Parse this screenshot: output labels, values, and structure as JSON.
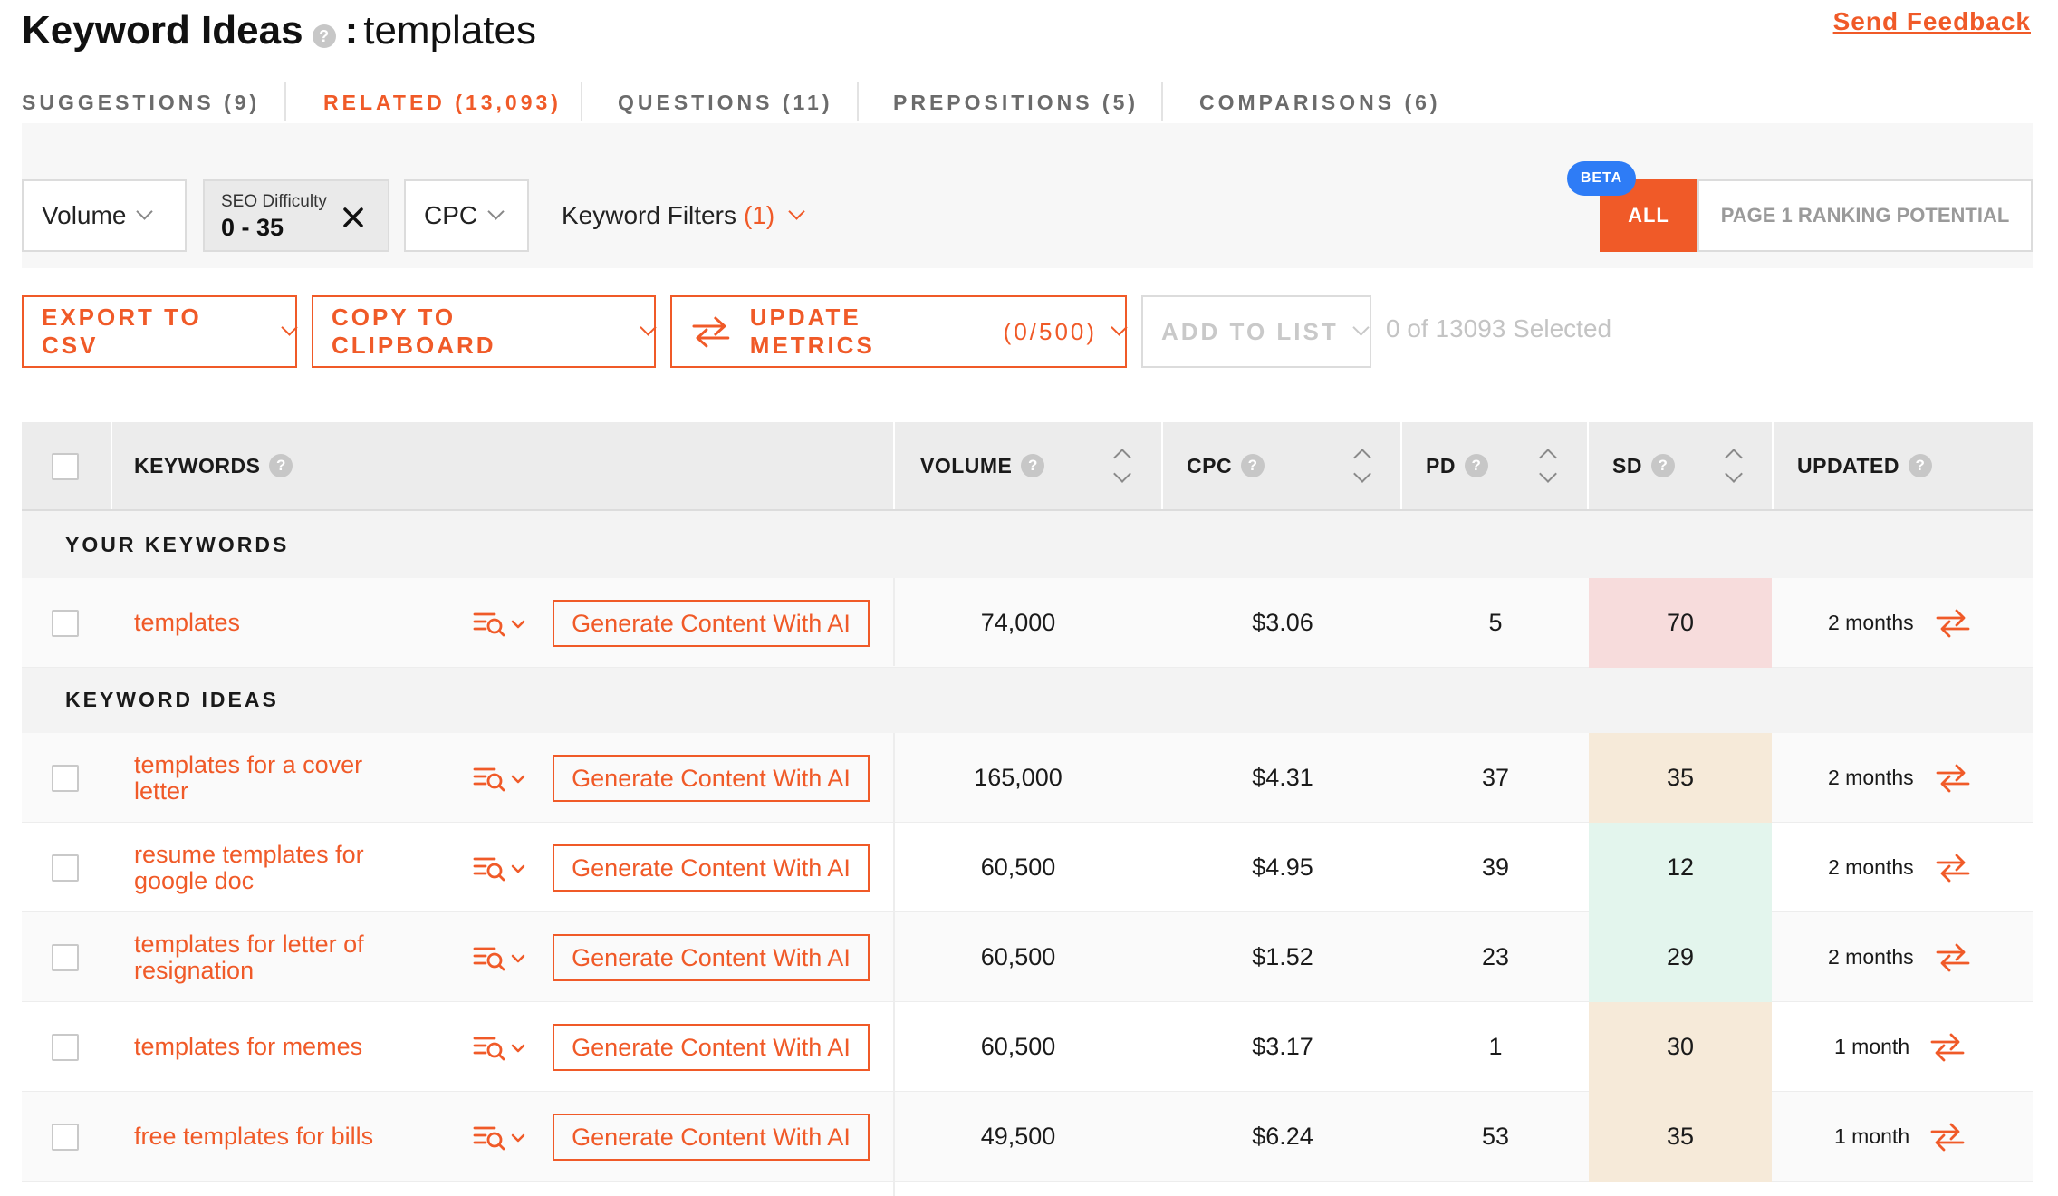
{
  "header": {
    "title": "Keyword Ideas",
    "separator": ":",
    "query": "templates",
    "feedback": "Send Feedback"
  },
  "tabs": [
    {
      "label": "SUGGESTIONS (9)",
      "active": false
    },
    {
      "label": "RELATED (13,093)",
      "active": true
    },
    {
      "label": "QUESTIONS (11)",
      "active": false
    },
    {
      "label": "PREPOSITIONS (5)",
      "active": false
    },
    {
      "label": "COMPARISONS (6)",
      "active": false
    }
  ],
  "filters": {
    "volume": "Volume",
    "seo_label": "SEO Difficulty",
    "seo_value": "0 - 35",
    "cpc": "CPC",
    "keyword_filters": "Keyword Filters",
    "keyword_filters_count": "(1)",
    "beta": "BETA",
    "all": "ALL",
    "page1": "PAGE 1 RANKING POTENTIAL"
  },
  "actions": {
    "export": "EXPORT TO CSV",
    "copy": "COPY TO CLIPBOARD",
    "update": "UPDATE METRICS",
    "update_count": "(0/500)",
    "add_list": "ADD TO LIST",
    "selected": "0 of 13093 Selected"
  },
  "table": {
    "headers": {
      "keywords": "KEYWORDS",
      "volume": "VOLUME",
      "cpc": "CPC",
      "pd": "PD",
      "sd": "SD",
      "updated": "UPDATED"
    },
    "your_section": "YOUR KEYWORDS",
    "ideas_section": "KEYWORD IDEAS",
    "generate_label": "Generate Content With AI",
    "your_rows": [
      {
        "keyword": "templates",
        "volume": "74,000",
        "cpc": "$3.06",
        "pd": "5",
        "sd": "70",
        "updated": "2 months"
      }
    ],
    "idea_rows": [
      {
        "keyword": "templates for a cover letter",
        "volume": "165,000",
        "cpc": "$4.31",
        "pd": "37",
        "sd": "35",
        "updated": "2 months"
      },
      {
        "keyword": "resume templates for google doc",
        "volume": "60,500",
        "cpc": "$4.95",
        "pd": "39",
        "sd": "12",
        "updated": "2 months"
      },
      {
        "keyword": "templates for letter of resignation",
        "volume": "60,500",
        "cpc": "$1.52",
        "pd": "23",
        "sd": "29",
        "updated": "2 months"
      },
      {
        "keyword": "templates for memes",
        "volume": "60,500",
        "cpc": "$3.17",
        "pd": "1",
        "sd": "30",
        "updated": "1 month"
      },
      {
        "keyword": "free templates for bills",
        "volume": "49,500",
        "cpc": "$6.24",
        "pd": "53",
        "sd": "35",
        "updated": "1 month"
      }
    ]
  },
  "colors": {
    "accent": "#f05a28",
    "beta": "#2e7cf6",
    "sd_hard": "#f7dcdc",
    "sd_medium": "#f6ead9",
    "sd_easy": "#e3f5ed"
  }
}
